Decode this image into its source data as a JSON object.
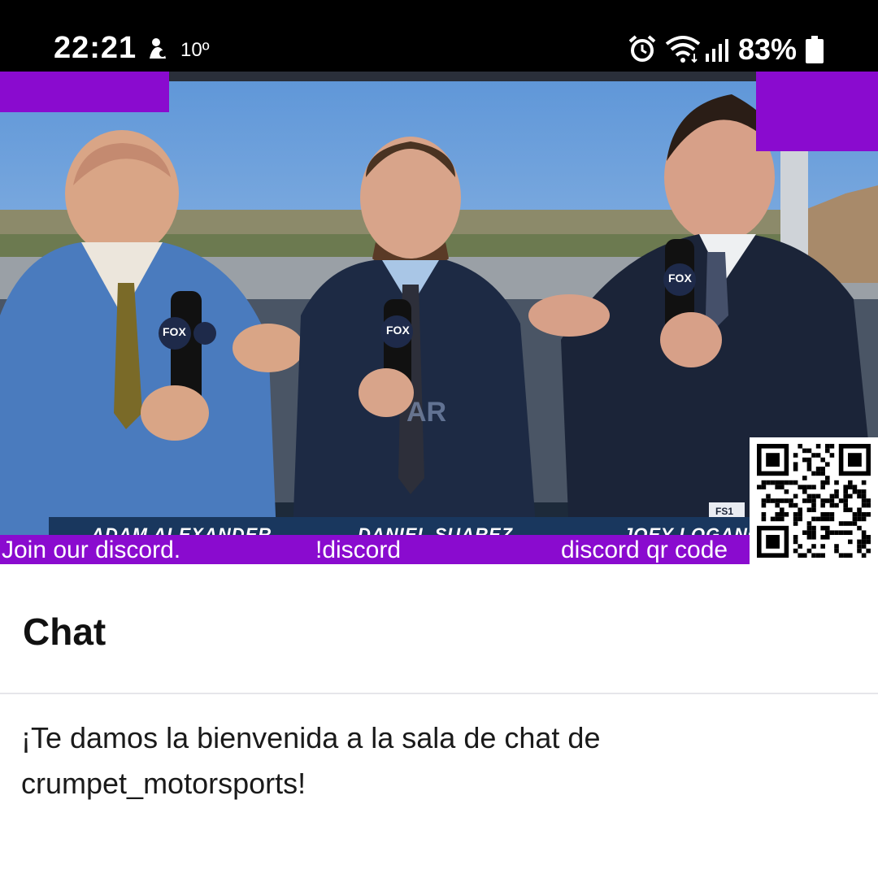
{
  "status_bar": {
    "time": "22:21",
    "temperature": "10º",
    "battery": "83%",
    "icons": [
      "weather-icon",
      "alarm-icon",
      "wifi-icon",
      "signal-icon",
      "battery-icon"
    ]
  },
  "video": {
    "lower_third_names": [
      "ADAM ALEXANDER",
      "DANIEL SUAREZ",
      "JOEY LOGANO"
    ],
    "banner": {
      "left": "Join our discord.",
      "center": "!discord",
      "right": "discord qr code"
    },
    "mic_flag": "FOX",
    "channel_logo": "FS1",
    "colors": {
      "overlay": "#8a0bcf"
    }
  },
  "chat": {
    "title": "Chat",
    "welcome_message": "¡Te damos la bienvenida a la sala de chat de crumpet_motorsports!"
  }
}
